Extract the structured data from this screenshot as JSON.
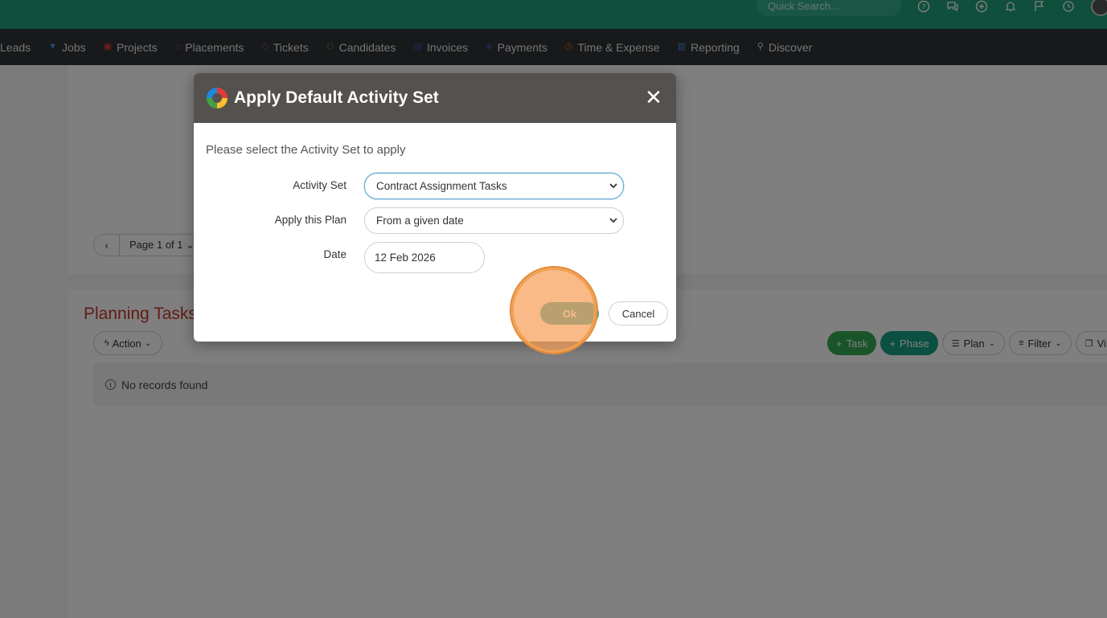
{
  "topbar": {
    "search_placeholder": "Quick Search...",
    "icons": [
      "help-icon",
      "chat-icon",
      "add-icon",
      "bell-icon",
      "flag-icon",
      "history-icon"
    ]
  },
  "nav": {
    "items": [
      {
        "label": "Leads",
        "icon": "leads-icon",
        "color": "#cccccc"
      },
      {
        "label": "Jobs",
        "icon": "jobs-icon",
        "color": "#4a90e2"
      },
      {
        "label": "Projects",
        "icon": "projects-icon",
        "color": "#e53935"
      },
      {
        "label": "Placements",
        "icon": "placements-icon",
        "color": "#7e57c2"
      },
      {
        "label": "Tickets",
        "icon": "tickets-icon",
        "color": "#7e57c2"
      },
      {
        "label": "Candidates",
        "icon": "candidates-icon",
        "color": "#43a047"
      },
      {
        "label": "Invoices",
        "icon": "invoices-icon",
        "color": "#3f51b5"
      },
      {
        "label": "Payments",
        "icon": "payments-icon",
        "color": "#3f51b5"
      },
      {
        "label": "Time & Expense",
        "icon": "time-icon",
        "color": "#ef6c00"
      },
      {
        "label": "Reporting",
        "icon": "reporting-icon",
        "color": "#4a90e2"
      },
      {
        "label": "Discover",
        "icon": "discover-icon",
        "color": "#dddddd"
      }
    ]
  },
  "pager": {
    "prev": "‹",
    "label": "Page 1 of 1 ⌄"
  },
  "planning": {
    "title": "Planning Tasks",
    "action_label": "Action",
    "task_label": "Task",
    "phase_label": "Phase",
    "plan_label": "Plan",
    "filter_label": "Filter",
    "view_label": "Vi",
    "empty_message": "No records found"
  },
  "modal": {
    "title": "Apply Default Activity Set",
    "close": "✕",
    "subtitle": "Please select the Activity Set to apply",
    "activity_set_label": "Activity Set",
    "activity_set_value": "Contract Assignment Tasks",
    "apply_plan_label": "Apply this Plan",
    "apply_plan_value": "From a given date",
    "date_label": "Date",
    "date_value": "12 Feb 2026",
    "ok_label": "Ok",
    "cancel_label": "Cancel"
  }
}
